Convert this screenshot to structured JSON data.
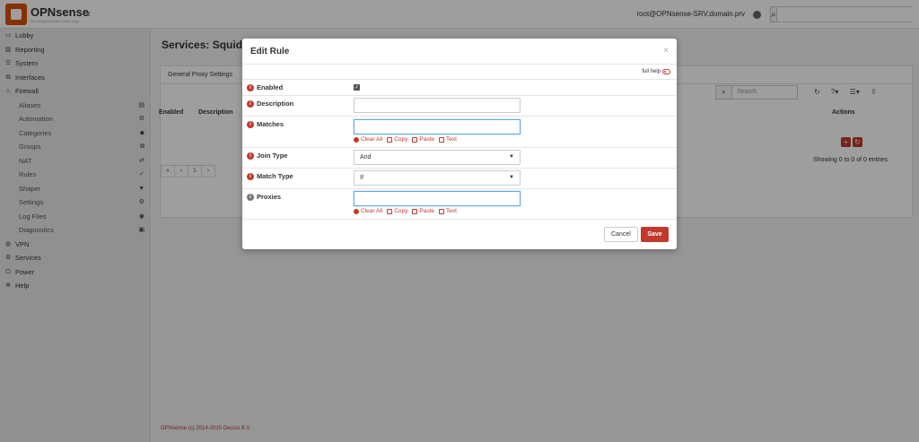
{
  "brand": {
    "name": "OPNsense",
    "tagline": "Securing networks made easy",
    "accent": "#d94f00"
  },
  "header": {
    "user": "root@OPNsense-SRV.domain.prv",
    "search_placeholder": ""
  },
  "sidebar": {
    "top": [
      {
        "label": "Lobby",
        "icon": "laptop-icon"
      },
      {
        "label": "Reporting",
        "icon": "chart-icon"
      },
      {
        "label": "System",
        "icon": "server-icon"
      },
      {
        "label": "Interfaces",
        "icon": "sitemap-icon"
      },
      {
        "label": "Firewall",
        "icon": "fire-icon"
      }
    ],
    "firewall_items": [
      {
        "label": "Aliases",
        "icon": "list-icon"
      },
      {
        "label": "Automation",
        "icon": "gear-icon"
      },
      {
        "label": "Categories",
        "icon": "tag-icon"
      },
      {
        "label": "Groups",
        "icon": "sitemap-icon"
      },
      {
        "label": "NAT",
        "icon": "exchange-icon"
      },
      {
        "label": "Rules",
        "icon": "check-icon"
      },
      {
        "label": "Shaper",
        "icon": "filter-icon"
      },
      {
        "label": "Settings",
        "icon": "cogs-icon"
      },
      {
        "label": "Log Files",
        "icon": "eye-icon"
      },
      {
        "label": "Diagnostics",
        "icon": "medkit-icon"
      }
    ],
    "bottom": [
      {
        "label": "VPN",
        "icon": "globe-icon"
      },
      {
        "label": "Services",
        "icon": "cogs-icon"
      },
      {
        "label": "Power",
        "icon": "plug-icon"
      },
      {
        "label": "Help",
        "icon": "lifebuoy-icon"
      }
    ]
  },
  "page": {
    "title": "Services: Squid",
    "tab": "General Proxy Settings",
    "grid": {
      "search_placeholder": "Search",
      "columns": {
        "enabled": "Enabled",
        "description": "Description",
        "actions": "Actions"
      },
      "entries_text": "Showing 0 to 0 of 0 entries",
      "pager": [
        "«",
        "‹",
        "1",
        "›"
      ]
    },
    "footer": "OPNsense (c) 2014-2025 Deciso B.V."
  },
  "modal": {
    "title": "Edit Rule",
    "full_help": "full help",
    "fields": {
      "enabled": {
        "label": "Enabled",
        "checked": true
      },
      "description": {
        "label": "Description",
        "value": ""
      },
      "matches": {
        "label": "Matches",
        "value": ""
      },
      "join_type": {
        "label": "Join Type",
        "value": "And"
      },
      "match_type": {
        "label": "Match Type",
        "value": "If"
      },
      "proxies": {
        "label": "Proxies",
        "value": ""
      }
    },
    "tools": {
      "clear_all": "Clear All",
      "copy": "Copy",
      "paste": "Paste",
      "text": "Text"
    },
    "buttons": {
      "cancel": "Cancel",
      "save": "Save"
    }
  }
}
